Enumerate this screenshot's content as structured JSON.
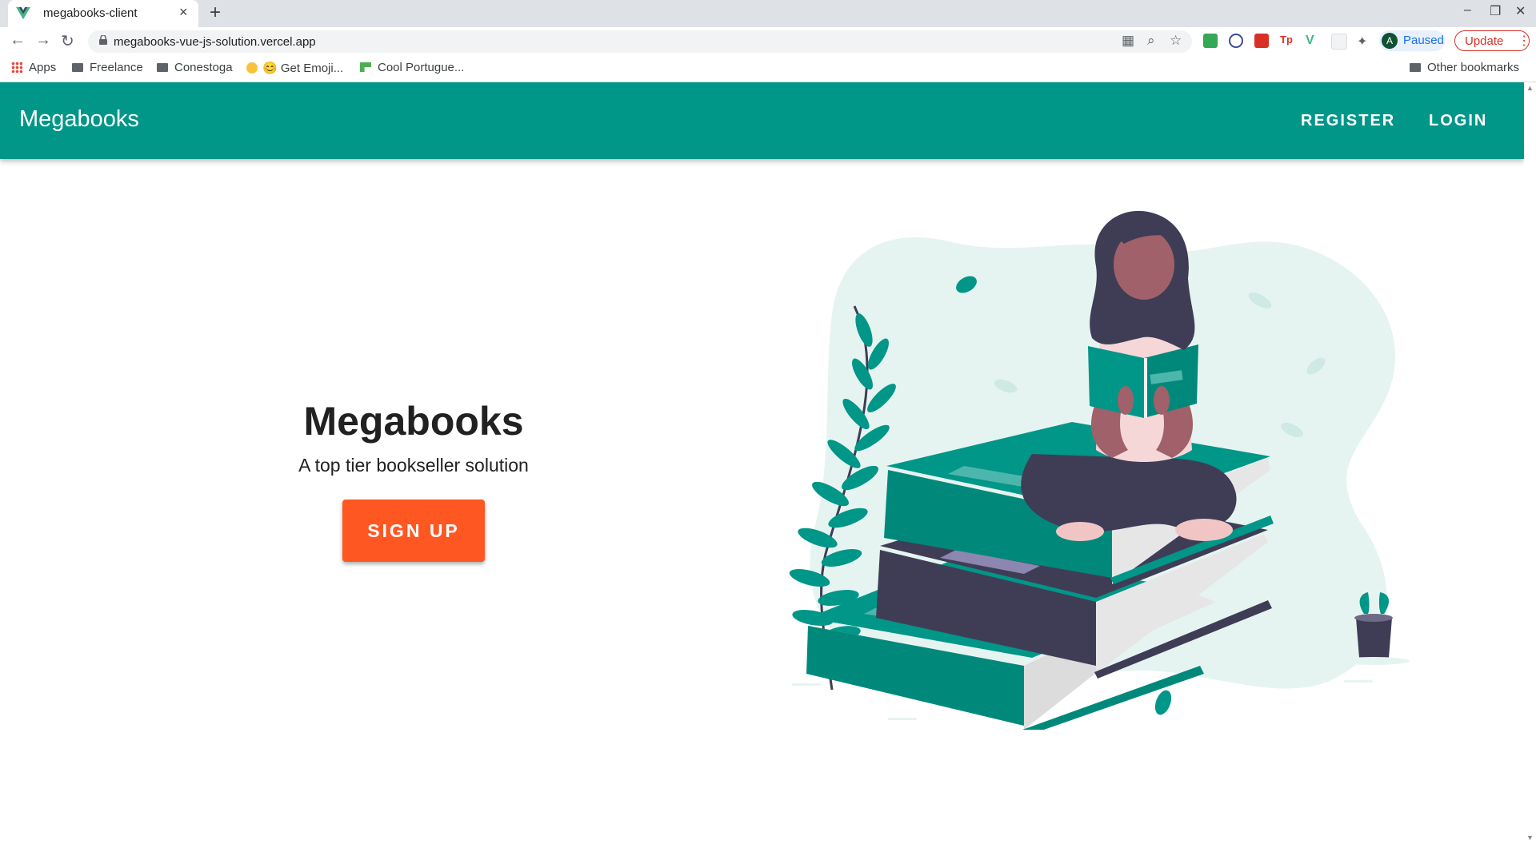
{
  "browser": {
    "tab_title": "megabooks-client",
    "tab_favicon": "vue-logo-icon",
    "new_tab": "+",
    "close_tab": "×",
    "url": "megabooks-vue-js-solution.vercel.app",
    "profile_initial": "A",
    "profile_status": "Paused",
    "update_label": "Update",
    "bookmarks": [
      "Apps",
      "Freelance",
      "Conestoga",
      "😊 Get Emoji...",
      "Cool Portugue..."
    ],
    "other_bookmarks": "Other bookmarks"
  },
  "app": {
    "brand": "Megabooks",
    "nav": [
      "REGISTER",
      "LOGIN"
    ],
    "hero_title": "Megabooks",
    "hero_subtitle": "A top tier bookseller solution",
    "cta": "SIGN UP",
    "colors": {
      "primary": "#009688",
      "accent": "#ff5722"
    }
  }
}
